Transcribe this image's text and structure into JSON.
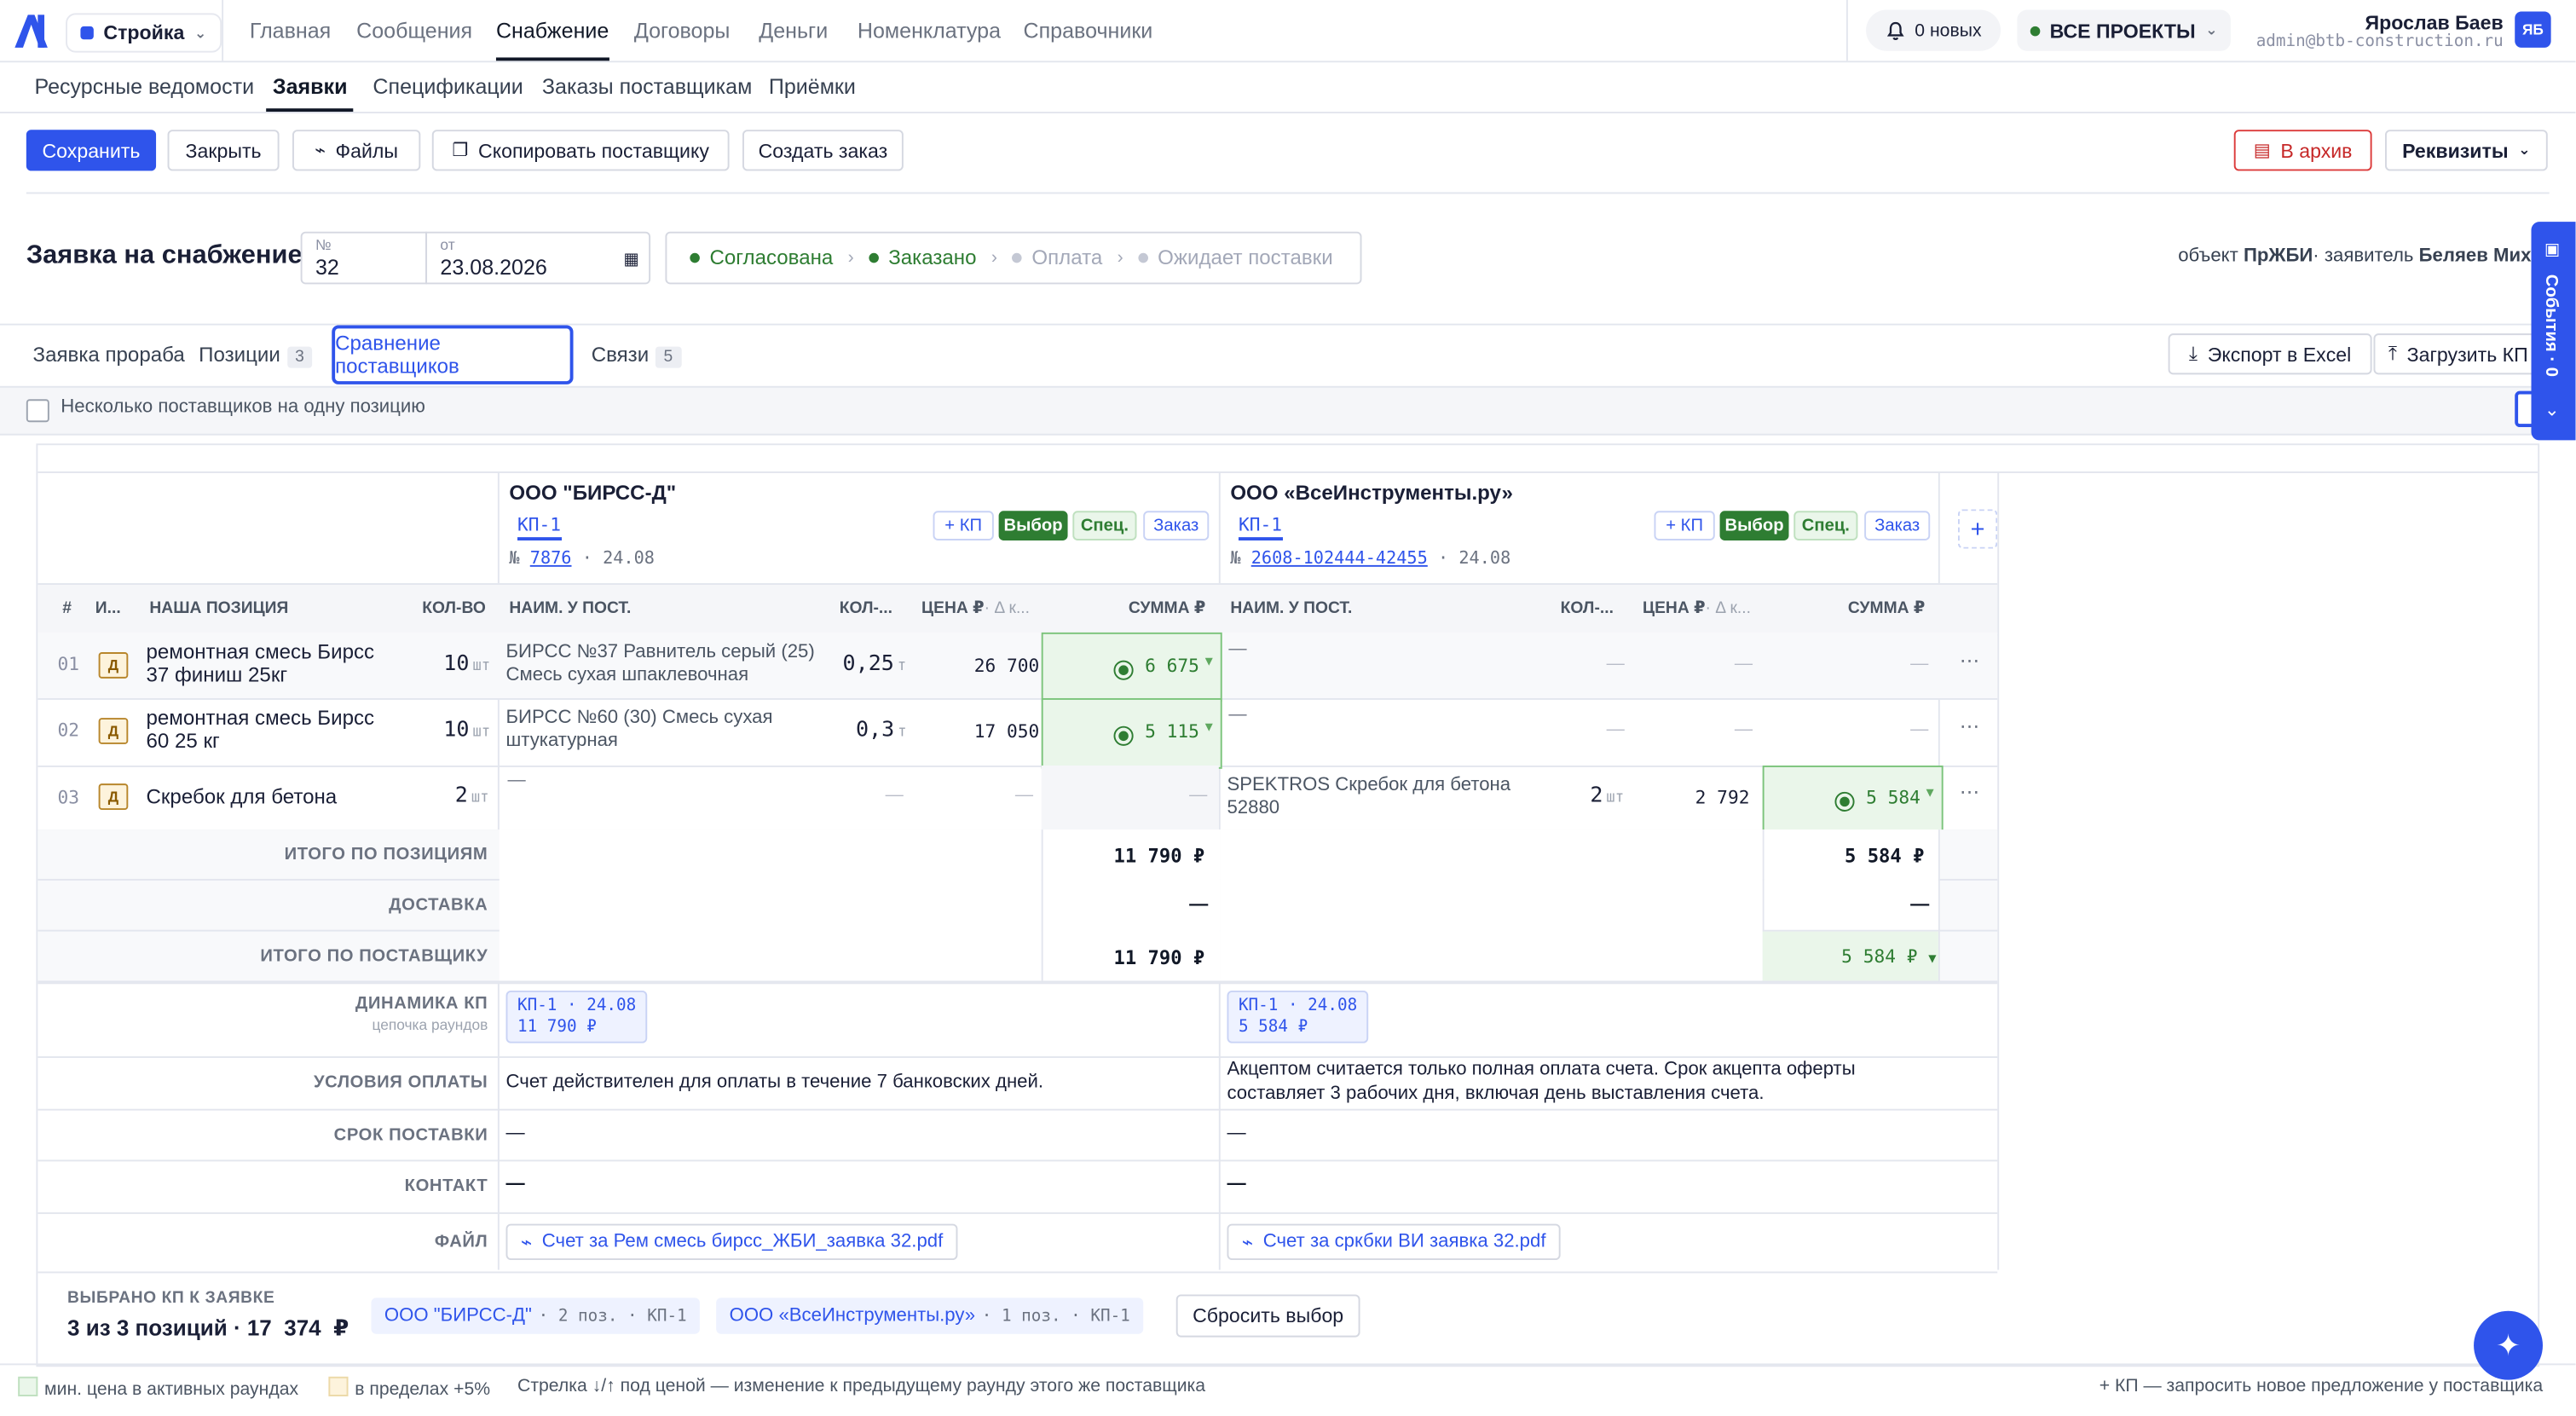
{
  "header": {
    "workspace": "Стройка",
    "nav": [
      "Главная",
      "Сообщения",
      "Снабжение",
      "Договоры",
      "Деньги",
      "Номенклатура",
      "Справочники"
    ],
    "notifications": "0 новых",
    "projects": "ВСЕ ПРОЕКТЫ",
    "user_name": "Ярослав Баев",
    "user_email": "admin@btb-construction.ru",
    "avatar": "ЯБ"
  },
  "subnav": [
    "Ресурсные ведомости",
    "Заявки",
    "Спецификации",
    "Заказы поставщикам",
    "Приёмки"
  ],
  "toolbar": {
    "save": "Сохранить",
    "close": "Закрыть",
    "files": "Файлы",
    "copy_supplier": "Скопировать поставщику",
    "create_order": "Создать заказ",
    "archive": "В архив",
    "requisites": "Реквизиты"
  },
  "doc": {
    "title": "Заявка на снабжение",
    "num_label": "№",
    "num": "32",
    "date_label": "от",
    "date": "23.08.2026",
    "steps": [
      {
        "label": "Согласована",
        "done": true
      },
      {
        "label": "Заказано",
        "done": true
      },
      {
        "label": "Оплата",
        "done": false
      },
      {
        "label": "Ожидает поставки",
        "done": false
      }
    ],
    "object_label": "объект",
    "object": "ПрЖБИ",
    "applicant_label": "· заявитель",
    "applicant": "Беляев Михаи"
  },
  "tabs": {
    "t1": "Заявка прораба",
    "t2": "Позиции",
    "t2_badge": "3",
    "t3": "Сравнение поставщиков",
    "t4": "Связи",
    "t4_badge": "5",
    "export": "Экспорт в Excel",
    "upload": "Загрузить КП"
  },
  "options": {
    "multi_supplier": "Несколько поставщиков на одну позицию"
  },
  "side_panel": "События · 0",
  "table": {
    "headers": {
      "num": "#",
      "i": "И...",
      "position": "НАША ПОЗИЦИЯ",
      "qty": "КОЛ-ВО",
      "sup_name": "НАИМ. У ПОСТ.",
      "sup_qty": "КОЛ-...",
      "price": "ЦЕНА ₽",
      "price_delta": "· Δ к...",
      "sum": "СУММА ₽"
    },
    "suppliers": [
      {
        "name": "ООО \"БИРСС-Д\"",
        "kp": "КП-1",
        "doc_prefix": "№",
        "doc_num": "7876",
        "doc_date": "· 24.08",
        "btn_kp": "+ КП",
        "btn_choice": "Выбор",
        "btn_spec": "Спец.",
        "btn_order": "Заказ"
      },
      {
        "name": "ООО «ВсеИнструменты.ру»",
        "kp": "КП-1",
        "doc_prefix": "№",
        "doc_num": "2608-102444-42455",
        "doc_date": "· 24.08",
        "btn_kp": "+ КП",
        "btn_choice": "Выбор",
        "btn_spec": "Спец.",
        "btn_order": "Заказ"
      }
    ],
    "rows": [
      {
        "num": "01",
        "tag": "Д",
        "name": "ремонтная смесь Бирсс 37 финиш 25кг",
        "qty": "10",
        "unit": "шт",
        "s1_name": "БИРСС №37 Равнитель серый (25) Смесь сухая шпаклевочная",
        "s1_qty": "0,25",
        "s1_unit": "т",
        "s1_price": "26 700",
        "s1_sum": "6 675",
        "s2_name": "—",
        "s2_qty": "—",
        "s2_price": "—",
        "s2_sum": "—"
      },
      {
        "num": "02",
        "tag": "Д",
        "name": "ремонтная смесь Бирсс 60 25 кг",
        "qty": "10",
        "unit": "шт",
        "s1_name": "БИРСС №60 (30) Смесь сухая штукатурная",
        "s1_qty": "0,3",
        "s1_unit": "т",
        "s1_price": "17 050",
        "s1_sum": "5 115",
        "s2_name": "—",
        "s2_qty": "—",
        "s2_price": "—",
        "s2_sum": "—"
      },
      {
        "num": "03",
        "tag": "Д",
        "name": "Скребок для бетона",
        "qty": "2",
        "unit": "шт",
        "s1_name": "—",
        "s1_qty": "—",
        "s1_price": "—",
        "s1_sum": "—",
        "s2_name": "SPEKTROS Скребок для бетона 52880",
        "s2_qty": "2",
        "s2_unit": "шт",
        "s2_price": "2 792",
        "s2_sum": "5 584"
      }
    ],
    "totals": {
      "positions_label": "ИТОГО ПО ПОЗИЦИЯМ",
      "positions_s1": "11 790 ₽",
      "positions_s2": "5 584 ₽",
      "delivery_label": "ДОСТАВКА",
      "delivery_s1": "—",
      "delivery_s2": "—",
      "supplier_label": "ИТОГО ПО ПОСТАВЩИКУ",
      "supplier_s1": "11 790 ₽",
      "supplier_s2": "5 584 ₽",
      "dynamics_label": "ДИНАМИКА КП",
      "dynamics_sub": "цепочка раундов",
      "dyn_s1_a": "КП-1 · 24.08",
      "dyn_s1_b": "11 790 ₽",
      "dyn_s2_a": "КП-1 · 24.08",
      "dyn_s2_b": "5 584 ₽",
      "payment_label": "УСЛОВИЯ ОПЛАТЫ",
      "payment_s1": "Счет действителен для оплаты в течение 7 банковских дней.",
      "payment_s2": "Акцептом считается только полная оплата счета. Срок акцепта оферты составляет 3 рабочих дня, включая день выставления счета.",
      "term_label": "СРОК ПОСТАВКИ",
      "term_s1": "—",
      "term_s2": "—",
      "contact_label": "КОНТАКТ",
      "contact_s1": "—",
      "contact_s2": "—",
      "file_label": "ФАЙЛ",
      "file_s1": "Счет за Рем смесь бирсс_ЖБИ_заявка 32.pdf",
      "file_s2": "Счет за сркбки ВИ заявка 32.pdf"
    }
  },
  "selection": {
    "label": "ВЫБРАНО КП К ЗАЯВКЕ",
    "summary": "3 из 3 позиций · 17  374  ₽",
    "chip1_name": "ООО \"БИРСС-Д\"",
    "chip1_meta": "· 2 поз. · КП-1",
    "chip2_name": "ООО «ВсеИнструменты.ру»",
    "chip2_meta": "· 1 поз. · КП-1",
    "reset": "Сбросить выбор"
  },
  "legend": {
    "min_price": "мин. цена в активных раундах",
    "within": "в пределах +5%",
    "arrow": "Стрелка ↓/↑ под ценой — изменение к предыдущему раунду этого же поставщика",
    "kp": "+ КП — запросить новое предложение у поставщика"
  },
  "colors": {
    "accent": "#2f54eb",
    "success": "#2e7d32",
    "danger": "#c62828",
    "min_price": "#eaf6ea",
    "within": "#fdf3dc"
  }
}
